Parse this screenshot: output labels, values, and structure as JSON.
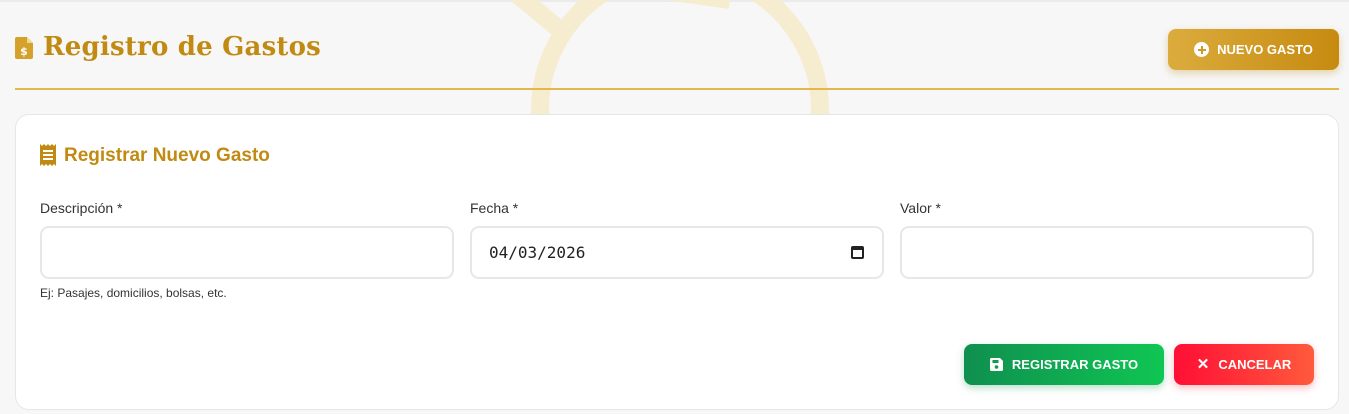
{
  "header": {
    "title": "Registro de Gastos",
    "new_button": "NUEVO GASTO"
  },
  "form": {
    "title": "Registrar Nuevo Gasto",
    "fields": {
      "descripcion": {
        "label": "Descripción *",
        "value": "",
        "hint": "Ej: Pasajes, domicilios, bolsas, etc."
      },
      "fecha": {
        "label": "Fecha *",
        "value": "04/03/2026"
      },
      "valor": {
        "label": "Valor *",
        "value": ""
      }
    },
    "save_button": "REGISTRAR GASTO",
    "cancel_button": "CANCELAR",
    "cancel_glyph": "✕"
  },
  "icons": {
    "title": "file-invoice-dollar-icon",
    "card": "receipt-icon",
    "new": "plus-circle-icon",
    "save": "floppy-disk-icon",
    "cancel": "x-icon",
    "calendar": "calendar-icon"
  },
  "colors": {
    "accent": "#c18a12",
    "save": "#0fa94f",
    "cancel": "#ff1f3a"
  }
}
